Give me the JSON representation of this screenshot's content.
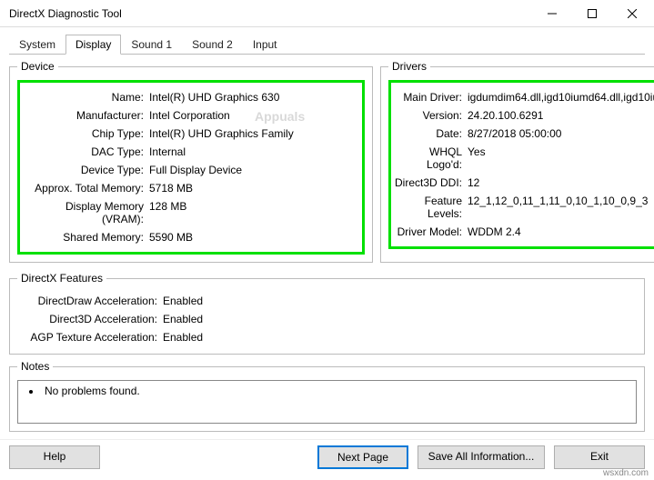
{
  "window": {
    "title": "DirectX Diagnostic Tool"
  },
  "tabs": [
    "System",
    "Display",
    "Sound 1",
    "Sound 2",
    "Input"
  ],
  "device": {
    "legend": "Device",
    "name_lbl": "Name:",
    "name": "Intel(R) UHD Graphics 630",
    "mfr_lbl": "Manufacturer:",
    "mfr": "Intel Corporation",
    "chip_lbl": "Chip Type:",
    "chip": "Intel(R) UHD Graphics Family",
    "dac_lbl": "DAC Type:",
    "dac": "Internal",
    "type_lbl": "Device Type:",
    "type": "Full Display Device",
    "total_lbl": "Approx. Total Memory:",
    "total": "5718 MB",
    "vram_lbl": "Display Memory (VRAM):",
    "vram": "128 MB",
    "shared_lbl": "Shared Memory:",
    "shared": "5590 MB"
  },
  "drivers": {
    "legend": "Drivers",
    "main_lbl": "Main Driver:",
    "main": "igdumdim64.dll,igd10iumd64.dll,igd10iu",
    "ver_lbl": "Version:",
    "ver": "24.20.100.6291",
    "date_lbl": "Date:",
    "date": "8/27/2018 05:00:00",
    "whql_lbl": "WHQL Logo'd:",
    "whql": "Yes",
    "ddi_lbl": "Direct3D DDI:",
    "ddi": "12",
    "feat_lbl": "Feature Levels:",
    "feat": "12_1,12_0,11_1,11_0,10_1,10_0,9_3",
    "model_lbl": "Driver Model:",
    "model": "WDDM 2.4"
  },
  "dxfeat": {
    "legend": "DirectX Features",
    "dd_lbl": "DirectDraw Acceleration:",
    "dd": "Enabled",
    "d3d_lbl": "Direct3D Acceleration:",
    "d3d": "Enabled",
    "agp_lbl": "AGP Texture Acceleration:",
    "agp": "Enabled"
  },
  "notes": {
    "legend": "Notes",
    "item1": "No problems found."
  },
  "buttons": {
    "help": "Help",
    "next": "Next Page",
    "save": "Save All Information...",
    "exit": "Exit"
  },
  "watermark": "Appuals",
  "footer_wm": "wsxdn.com"
}
